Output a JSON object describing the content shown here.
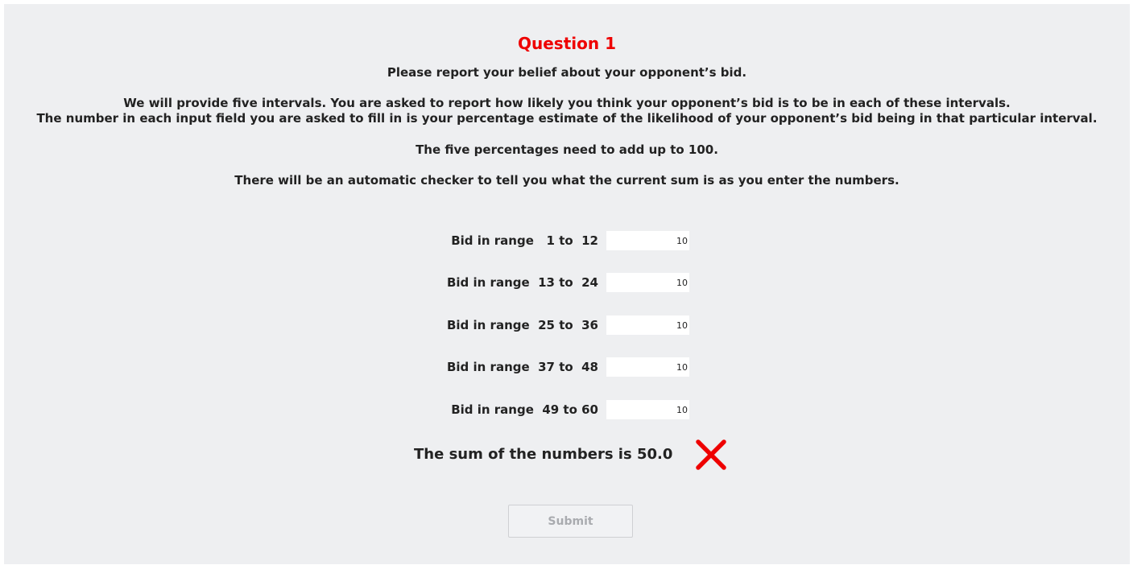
{
  "title": "Question 1",
  "instructions": {
    "line1": "Please report your belief about your opponent’s bid.",
    "line2": "We will provide five intervals.  You are asked to report how likely you think your opponent’s bid is to be in each of these intervals.",
    "line3": "The number in each input field you are asked to fill in is your percentage estimate of the likelihood of your opponent’s bid being in that particular interval.",
    "line4": "The five percentages need to add up to 100.",
    "line5": "There will be an automatic checker to tell you what the current sum is as you enter the numbers."
  },
  "ranges": [
    {
      "label": "Bid in range   1 to  12",
      "value": "10"
    },
    {
      "label": "Bid in range  13 to  24",
      "value": "10"
    },
    {
      "label": "Bid in range  25 to  36",
      "value": "10"
    },
    {
      "label": "Bid in range  37 to  48",
      "value": "10"
    },
    {
      "label": "Bid in range  49 to 60",
      "value": "10"
    }
  ],
  "sum_text": "The sum of the numbers is 50.0",
  "sum_status_icon": "cross-icon",
  "status_color": "#ee0000",
  "submit_label": "Submit"
}
